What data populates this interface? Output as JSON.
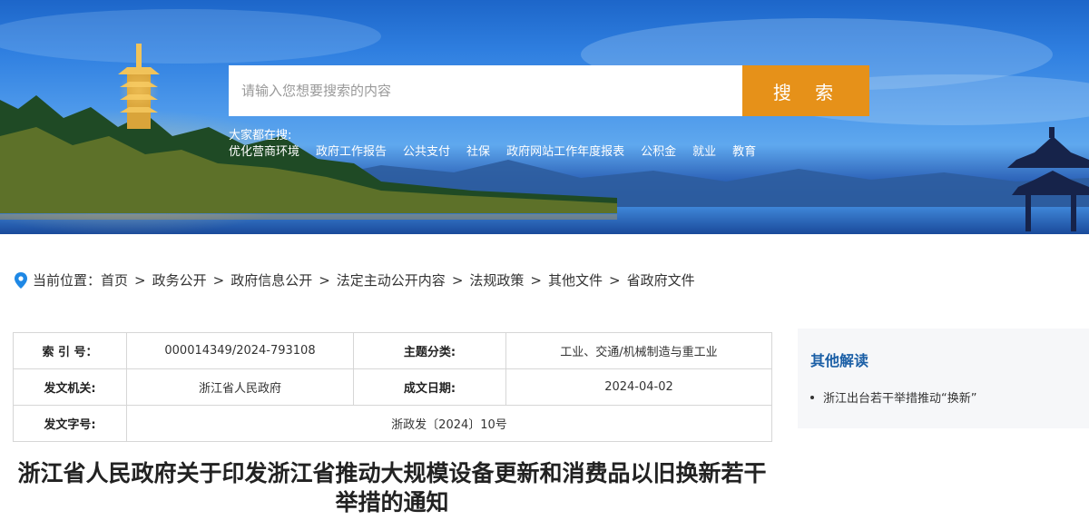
{
  "search": {
    "placeholder": "请输入您想要搜索的内容",
    "button_label": "搜 索"
  },
  "hot_searches": {
    "label": "大家都在搜:",
    "items": [
      "优化营商环境",
      "政府工作报告",
      "公共支付",
      "社保",
      "政府网站工作年度报表",
      "公积金",
      "就业",
      "教育"
    ]
  },
  "breadcrumb": {
    "prefix": "当前位置：",
    "items": [
      "首页",
      "政务公开",
      "政府信息公开",
      "法定主动公开内容",
      "法规政策",
      "其他文件",
      "省政府文件"
    ],
    "separator": ">"
  },
  "info_table": {
    "index_no_label": "索 引 号：",
    "index_no_value": "000014349/2024-793108",
    "topic_label": "主题分类:",
    "topic_value": "工业、交通/机械制造与重工业",
    "issuer_label": "发文机关:",
    "issuer_value": "浙江省人民政府",
    "date_label": "成文日期:",
    "date_value": "2024-04-02",
    "doc_no_label": "发文字号:",
    "doc_no_value": "浙政发〔2024〕10号"
  },
  "document": {
    "title": "浙江省人民政府关于印发浙江省推动大规模设备更新和消费品以旧换新若干举措的通知"
  },
  "sidebar": {
    "title": "其他解读",
    "items": [
      "浙江出台若干举措推动“换新”"
    ]
  },
  "colors": {
    "search_button": "#e69119",
    "sidebar_title": "#1b5fa6",
    "pin_icon": "#1e88e5",
    "sidebar_bg": "#f6f7f9"
  }
}
